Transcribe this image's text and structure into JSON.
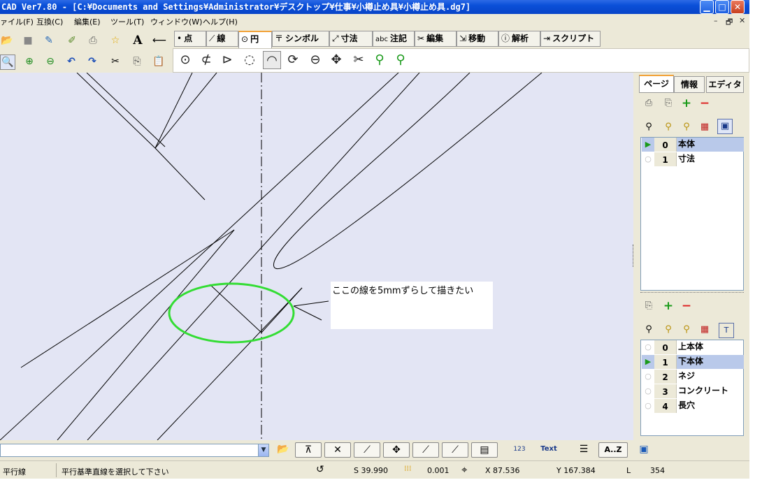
{
  "window": {
    "title": "CAD Ver7.80 - [C:¥Documents and Settings¥Administrator¥デスクトップ¥仕事¥小樽止め具¥小樽止め具.dg7]",
    "min_label": "▁",
    "max_label": "□",
    "close_label": "✕"
  },
  "menu": {
    "items": [
      "ァイル(F)",
      "互換(C)",
      "編集(E)",
      "ツール(T)",
      "ウィンドウ(W)",
      "ヘルプ(H)"
    ],
    "mdi_controls": [
      "–",
      "🗗",
      "✕"
    ]
  },
  "toolbar": {
    "row1": [
      "open-folder-icon",
      "save-icon",
      "edit-icon",
      "tool-icon",
      "print-icon",
      "star-icon",
      "text-icon",
      "arrow-left-icon"
    ],
    "row1_glyphs": [
      "📂",
      "■",
      "✎",
      "✐",
      "⎙",
      "☆",
      "A",
      "⟵"
    ],
    "row2": [
      "zoom-icon",
      "zoom-in-icon",
      "zoom-out-icon",
      "undo-icon",
      "redo-icon",
      "cut-icon",
      "copy-icon",
      "paste-icon"
    ],
    "row2_glyphs": [
      "🔍",
      "⊕",
      "⊖",
      "↶",
      "↷",
      "✂",
      "⎘",
      "📋"
    ]
  },
  "tabs": [
    {
      "icon": "•",
      "label": "点"
    },
    {
      "icon": "⟋",
      "label": "線"
    },
    {
      "icon": "⊙",
      "label": "円"
    },
    {
      "icon": "〒",
      "label": "シンボル"
    },
    {
      "icon": "⤢",
      "label": "寸法"
    },
    {
      "icon": "abc",
      "label": "注記"
    },
    {
      "icon": "✂",
      "label": "編集"
    },
    {
      "icon": "⇲",
      "label": "移動"
    },
    {
      "icon": "ⓘ",
      "label": "解析"
    },
    {
      "icon": "⇥",
      "label": "スクリプト"
    }
  ],
  "active_tab": "円",
  "circle_tools": [
    "⊙",
    "⊄",
    "⊳",
    "◌",
    "◠",
    "⟳",
    "⊖",
    "✥",
    "✂",
    "⚲",
    "⚲"
  ],
  "callout": {
    "text": "ここの線を5mmずらして描きたい"
  },
  "colors": {
    "canvas": "#e3e5f4",
    "highlight_ellipse": "#33dd33",
    "title_bar": "#0a4fd8",
    "selected_row": "#b9c9ea"
  },
  "right_panel": {
    "tabs": [
      "ページ",
      "情報",
      "エディタ"
    ],
    "active_tab": "ページ",
    "page_icons": [
      "⎙",
      "⎘",
      "+",
      "−"
    ],
    "layer_icons": [
      "⚲",
      "⚲",
      "⚲",
      "▦",
      "▣"
    ],
    "pages": [
      {
        "index": "0",
        "name": "本体",
        "selected": true
      },
      {
        "index": "1",
        "name": "寸法",
        "selected": false
      }
    ],
    "layer_tool_icons": [
      "⎘",
      "+",
      "−"
    ],
    "layer_tool_icons2": [
      "⚲",
      "⚲",
      "⚲",
      "▦",
      "T"
    ],
    "layers": [
      {
        "index": "0",
        "name": "上本体",
        "selected": false
      },
      {
        "index": "1",
        "name": "下本体",
        "selected": true
      },
      {
        "index": "2",
        "name": "ネジ",
        "selected": false
      },
      {
        "index": "3",
        "name": "コンクリート",
        "selected": false
      },
      {
        "index": "4",
        "name": "長穴",
        "selected": false
      }
    ]
  },
  "bottom_toolbar": {
    "buttons": [
      "⊼",
      "✕",
      "⟋",
      "✥",
      "⟋",
      "⟋",
      "▤",
      "123",
      "Text",
      "☰",
      "A..Z",
      "▣"
    ]
  },
  "status": {
    "mode": "平行線",
    "message": "平行基準直線を選択して下さい",
    "s_value": "S 39.990",
    "step": "0.001",
    "x": "X 87.536",
    "y": "Y 167.384",
    "l_label": "L",
    "l_value": "354"
  }
}
